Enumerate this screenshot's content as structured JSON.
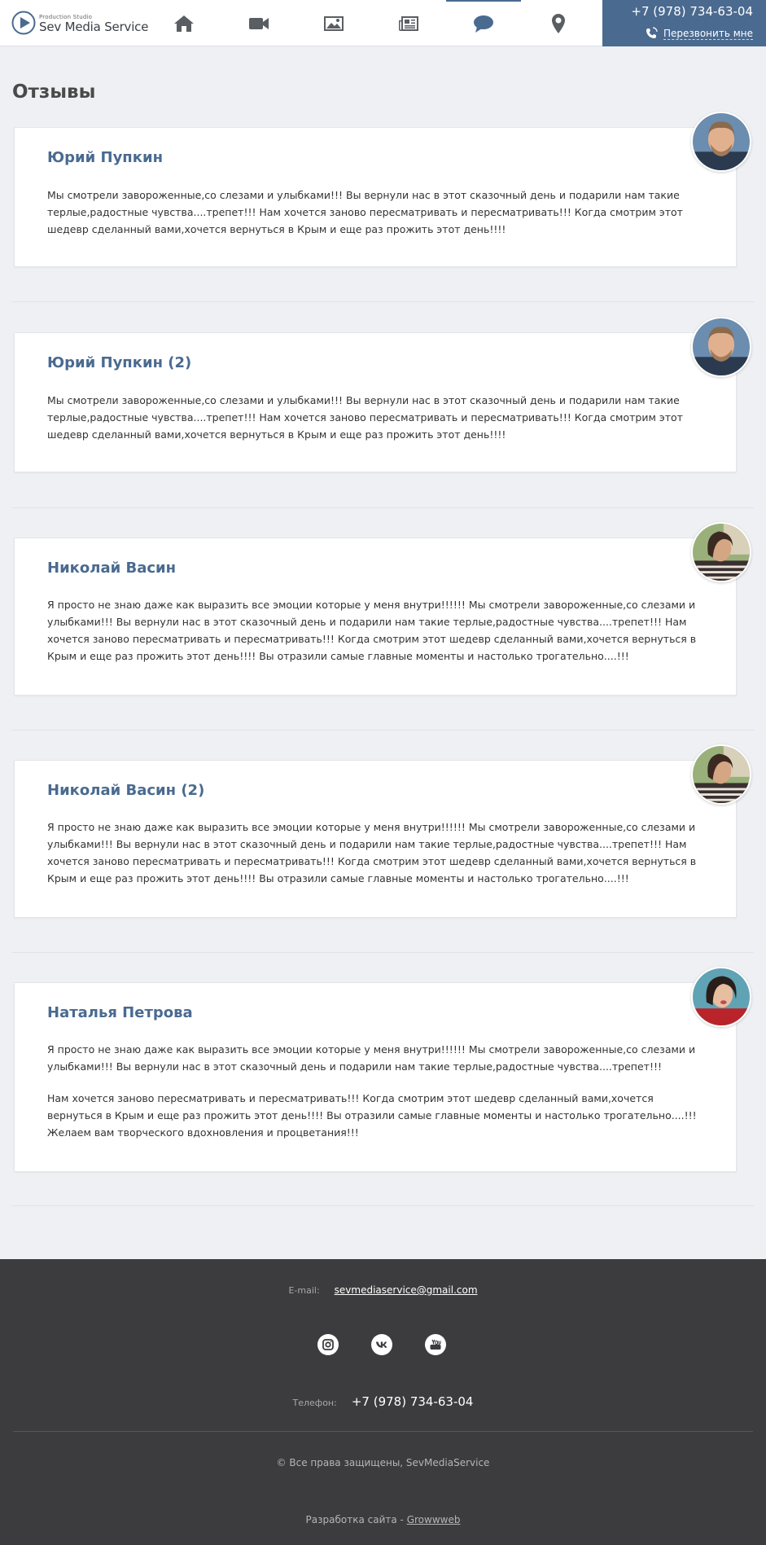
{
  "header": {
    "logo_small": "Production Studio",
    "logo_big": "Sev Media Service",
    "phone": "+7 (978) 734-63-04",
    "callback": "Перезвонить мне",
    "nav": [
      {
        "icon": "home-icon"
      },
      {
        "icon": "video-camera-icon"
      },
      {
        "icon": "image-icon"
      },
      {
        "icon": "newspaper-icon"
      },
      {
        "icon": "comment-icon",
        "active": true
      },
      {
        "icon": "map-pin-icon"
      }
    ]
  },
  "page": {
    "title": "Отзывы"
  },
  "reviews": [
    {
      "name": "Юрий Пупкин",
      "paragraphs": [
        "Мы смотрели завороженные,со слезами и улыбками!!! Вы вернули нас в этот сказочный день и подарили нам такие терлые,радостные чувства....трепет!!! Нам хочется заново пересматривать и пересматривать!!! Когда смотрим этот шедевр сделанный вами,хочется вернуться в Крым и еще раз прожить этот день!!!!"
      ]
    },
    {
      "name": "Юрий Пупкин (2)",
      "paragraphs": [
        "Мы смотрели завороженные,со слезами и улыбками!!! Вы вернули нас в этот сказочный день и подарили нам такие терлые,радостные чувства....трепет!!! Нам хочется заново пересматривать и пересматривать!!! Когда смотрим этот шедевр сделанный вами,хочется вернуться в Крым и еще раз прожить этот день!!!!"
      ]
    },
    {
      "name": "Николай Васин",
      "paragraphs": [
        "Я просто не знаю даже как выразить все эмоции которые у меня внутри!!!!!! Мы смотрели завороженные,со слезами и улыбками!!! Вы вернули нас в этот сказочный день и подарили нам такие терлые,радостные чувства....трепет!!! Нам хочется заново пересматривать и пересматривать!!! Когда смотрим этот шедевр сделанный вами,хочется вернуться в Крым и еще раз прожить этот день!!!! Вы отразили самые главные моменты и настолько трогательно....!!!"
      ]
    },
    {
      "name": "Николай Васин (2)",
      "paragraphs": [
        "Я просто не знаю даже как выразить все эмоции которые у меня внутри!!!!!! Мы смотрели завороженные,со слезами и улыбками!!! Вы вернули нас в этот сказочный день и подарили нам такие терлые,радостные чувства....трепет!!! Нам хочется заново пересматривать и пересматривать!!! Когда смотрим этот шедевр сделанный вами,хочется вернуться в Крым и еще раз прожить этот день!!!! Вы отразили самые главные моменты и настолько трогательно....!!!"
      ]
    },
    {
      "name": "Наталья Петрова",
      "paragraphs": [
        "Я просто не знаю даже как выразить все эмоции которые у меня внутри!!!!!! Мы смотрели завороженные,со слезами и улыбками!!! Вы вернули нас в этот сказочный день и подарили нам такие терлые,радостные чувства....трепет!!!",
        "Нам хочется заново пересматривать и пересматривать!!! Когда смотрим этот шедевр сделанный вами,хочется вернуться в Крым и еще раз прожить этот день!!!! Вы отразили самые главные моменты и настолько трогательно....!!! Желаем вам творческого вдохновления и процветания!!!"
      ]
    }
  ],
  "footer": {
    "email_label": "E-mail:",
    "email": "sevmediaservice@gmail.com",
    "socials": [
      "instagram-icon",
      "vk-icon",
      "youtube-icon"
    ],
    "phone_label": "Телефон:",
    "phone": "+7 (978) 734-63-04",
    "copyright": "© Все права защищены, SevMediaService",
    "dev_label": "Разработка сайта - ",
    "dev_link": "Growwweb"
  },
  "colors": {
    "accent": "#4a6a90",
    "footer_bg": "#3c3c3e",
    "page_bg": "#eef0f4"
  }
}
